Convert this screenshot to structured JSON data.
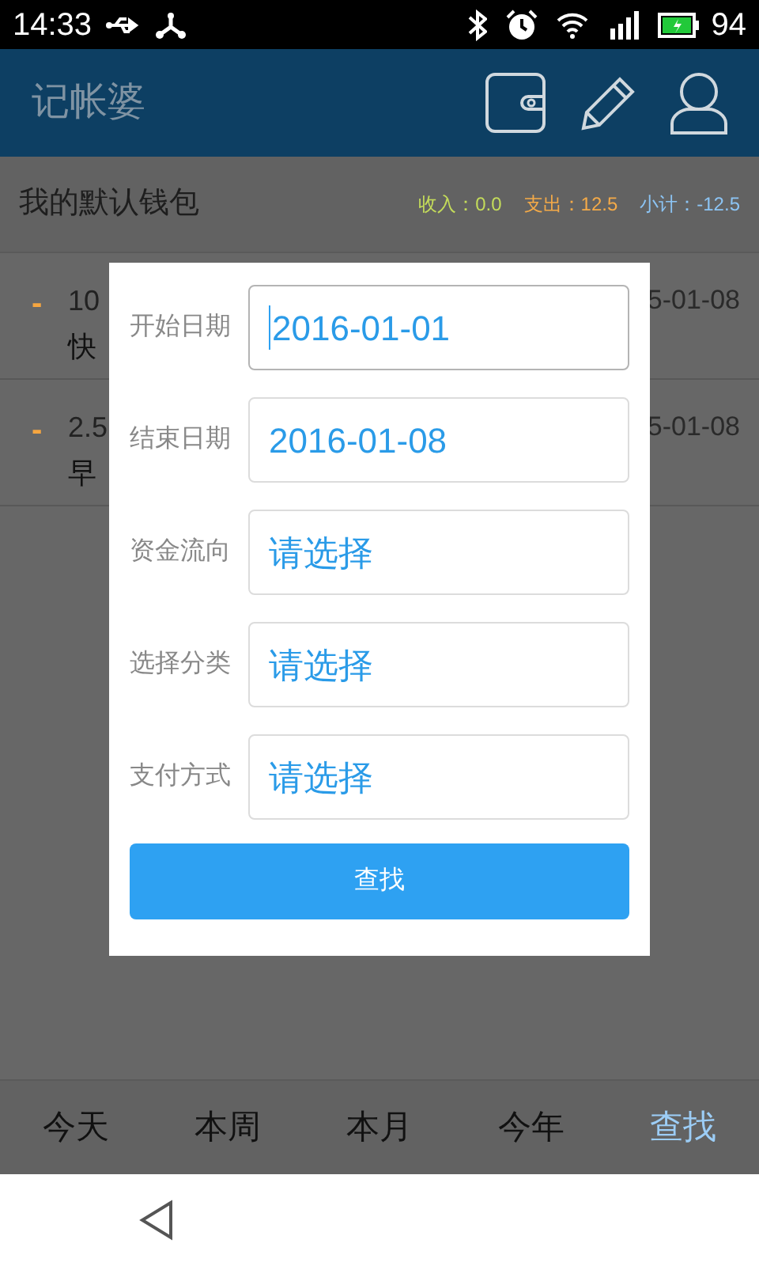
{
  "status_bar": {
    "time": "14:33",
    "battery": "94"
  },
  "app_bar": {
    "title": "记帐婆"
  },
  "wallet": {
    "name": "我的默认钱包",
    "summary": [
      {
        "label": "收入：0.0",
        "color": "#c4dc5a"
      },
      {
        "label": "支出：12.5",
        "color": "#f4aa48"
      },
      {
        "label": "小计：-12.5",
        "color": "#8cc4f4"
      }
    ]
  },
  "records": [
    {
      "sign": "-",
      "amount": "10",
      "category": "快",
      "date": "5-01-08"
    },
    {
      "sign": "-",
      "amount": "2.5",
      "category": "早",
      "date": "5-01-08"
    }
  ],
  "dialog": {
    "fields": [
      {
        "label": "开始日期",
        "value": "2016-01-01",
        "focused": true
      },
      {
        "label": "结束日期",
        "value": "2016-01-08",
        "focused": false
      },
      {
        "label": "资金流向",
        "value": "请选择",
        "focused": false
      },
      {
        "label": "选择分类",
        "value": "请选择",
        "focused": false
      },
      {
        "label": "支付方式",
        "value": "请选择",
        "focused": false
      }
    ],
    "button": "查找"
  },
  "bottom_tabs": [
    {
      "label": "今天",
      "selected": false
    },
    {
      "label": "本周",
      "selected": false
    },
    {
      "label": "本月",
      "selected": false
    },
    {
      "label": "今年",
      "selected": false
    },
    {
      "label": "查找",
      "selected": true
    }
  ]
}
